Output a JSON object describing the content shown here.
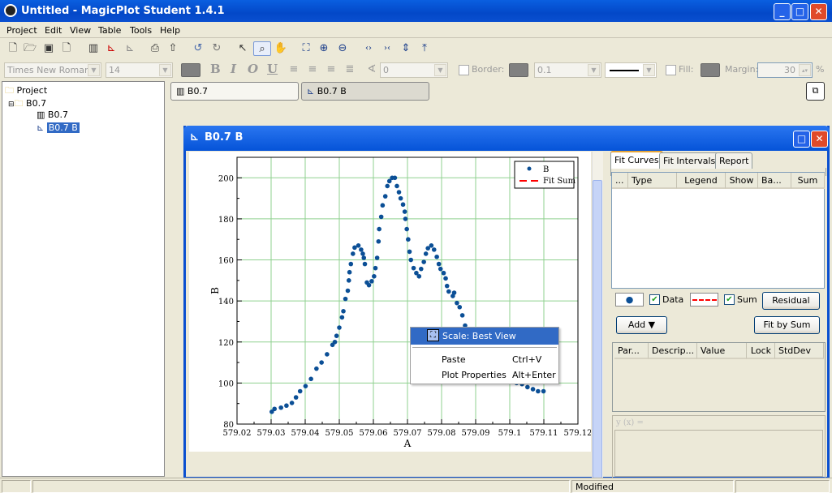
{
  "window": {
    "title": "Untitled - MagicPlot Student 1.4.1",
    "controls": [
      "minimize",
      "maximize",
      "close"
    ]
  },
  "menu": [
    "Project",
    "Edit",
    "View",
    "Table",
    "Tools",
    "Help"
  ],
  "toolbar": {
    "icons": [
      "new-project-icon",
      "open-icon",
      "save-icon",
      "save-as-icon",
      "new-table-icon",
      "new-plot-icon",
      "new-fit-plot-icon",
      "print-icon",
      "export-icon",
      "undo-icon",
      "redo-icon",
      "pointer-icon",
      "zoom-box-icon",
      "hand-icon",
      "best-view-icon",
      "zoom-in-icon",
      "zoom-out-icon",
      "expand-horizontal-icon",
      "shrink-horizontal-icon",
      "expand-vertical-icon",
      "shrink-vertical-icon"
    ]
  },
  "format_bar": {
    "font": "Times New Roman",
    "size": "14",
    "bold": "B",
    "italic": "I",
    "overline": "O",
    "underline": "U",
    "angle": "0",
    "border_label": "Border:",
    "border_width": "0.1",
    "fill_label": "Fill:",
    "margin_label": "Margin:",
    "margin": "30",
    "margin_unit": "%"
  },
  "tree": {
    "root": "Project",
    "folder": "B0.7",
    "items": [
      "B0.7",
      "B0.7 B"
    ]
  },
  "doc_tabs": [
    "B0.7",
    "B0.7 B"
  ],
  "plot_window": {
    "title": "B0.7 B"
  },
  "chart_data": {
    "type": "scatter",
    "xlabel": "A",
    "ylabel": "B",
    "xlim": [
      579.02,
      579.12
    ],
    "ylim": [
      80,
      210
    ],
    "xticks": [
      "579.02",
      "579.03",
      "579.04",
      "579.05",
      "579.06",
      "579.07",
      "579.08",
      "579.09",
      "579.1",
      "579.11",
      "579.12"
    ],
    "yticks": [
      "80",
      "100",
      "120",
      "140",
      "160",
      "180",
      "200"
    ],
    "grid": true,
    "legend_position": "top-right",
    "legend": [
      {
        "name": "B",
        "style": "points",
        "color": "#0b4f96"
      },
      {
        "name": "Fit Sum",
        "style": "dashed-line",
        "color": "#ff0000"
      }
    ],
    "series": [
      {
        "name": "B",
        "x": [
          579.0302,
          579.031,
          579.0329,
          579.0345,
          579.0361,
          579.0373,
          579.0385,
          579.0401,
          579.0417,
          579.0433,
          579.0448,
          579.0464,
          579.048,
          579.0487,
          579.0492,
          579.05,
          579.0508,
          579.0512,
          579.0518,
          579.0525,
          579.0528,
          579.053,
          579.0534,
          579.054,
          579.0545,
          579.0556,
          579.0564,
          579.0569,
          579.0572,
          579.0575,
          579.0581,
          579.0587,
          579.0595,
          579.0602,
          579.0606,
          579.0611,
          579.0615,
          579.0617,
          579.0623,
          579.0627,
          579.0635,
          579.0641,
          579.0647,
          579.0655,
          579.0663,
          579.0669,
          579.0675,
          579.068,
          579.0687,
          579.0692,
          579.0694,
          579.0698,
          579.0702,
          579.0706,
          579.071,
          579.0718,
          579.0726,
          579.0734,
          579.074,
          579.0748,
          579.0754,
          579.076,
          579.077,
          579.0778,
          579.0786,
          579.0792,
          579.0797,
          579.0806,
          579.0812,
          579.0816,
          579.0821,
          579.0833,
          579.0837,
          579.0845,
          579.0853,
          579.0861,
          579.0869,
          579.102,
          579.1036,
          579.1052,
          579.1068,
          579.1083,
          579.1099
        ],
        "y": [
          86,
          87.4,
          88,
          89,
          90.3,
          93,
          96,
          98.5,
          102,
          107,
          110,
          114,
          118.6,
          120,
          123,
          127,
          132,
          135,
          141,
          145,
          150,
          154,
          158,
          163,
          166,
          167,
          165,
          163,
          161,
          158,
          149,
          147.7,
          149.6,
          152,
          156,
          161,
          169,
          175,
          181,
          186.6,
          191,
          196,
          198.4,
          200,
          200,
          196,
          193,
          190,
          187,
          183.5,
          180,
          175,
          170,
          164,
          160,
          156,
          153.6,
          152,
          155.6,
          159,
          163,
          165.7,
          167,
          165,
          161.5,
          158,
          155.6,
          153.6,
          151,
          147.3,
          144.6,
          142.4,
          144,
          139,
          137,
          133,
          128,
          100,
          99.5,
          98,
          97,
          96,
          96
        ]
      }
    ]
  },
  "fit_panel": {
    "tabs": [
      "Fit Curves",
      "Fit Intervals",
      "Report"
    ],
    "curves_columns": [
      "...",
      "Type",
      "Legend",
      "Show",
      "Ba...",
      "Sum"
    ],
    "data_label": "Data",
    "data_checked": true,
    "sum_label": "Sum",
    "sum_checked": true,
    "residual": "Residual",
    "add": "Add ▼",
    "fit_by_sum": "Fit by Sum",
    "param_columns": [
      "Par...",
      "Descrip...",
      "Value",
      "Lock",
      "StdDev"
    ],
    "formula": "y (x) ="
  },
  "context_menu": {
    "items": [
      {
        "label": "Scale: Best View",
        "shortcut": ""
      },
      {
        "label": "Paste",
        "shortcut": "Ctrl+V"
      },
      {
        "label": "Plot Properties",
        "shortcut": "Alt+Enter"
      }
    ]
  },
  "status": {
    "text": "Modified"
  }
}
